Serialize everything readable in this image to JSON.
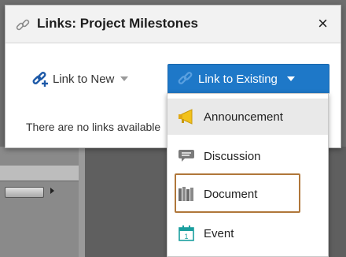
{
  "dialog": {
    "title": "Links: Project Milestones",
    "close_glyph": "×",
    "link_icon": "link-icon"
  },
  "toolbar": {
    "link_new_label": "Link to New",
    "link_existing_label": "Link to Existing"
  },
  "empty_message": "There are no links available",
  "menu": {
    "items": [
      {
        "label": "Announcement",
        "icon": "megaphone-icon"
      },
      {
        "label": "Discussion",
        "icon": "chat-bubble-icon"
      },
      {
        "label": "Document",
        "icon": "document-library-icon"
      },
      {
        "label": "Event",
        "icon": "calendar-icon"
      }
    ]
  },
  "colors": {
    "accent": "#1e78c8",
    "highlight_border": "#b0773a"
  }
}
